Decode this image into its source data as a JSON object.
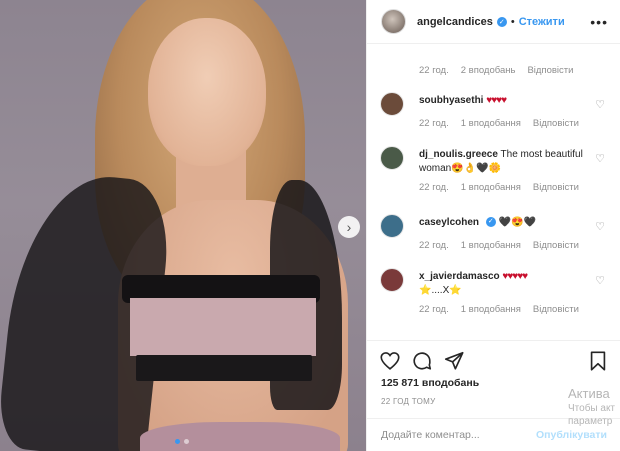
{
  "post": {
    "photo_alt": "",
    "next_icon": "chevron-right-icon",
    "carousel_dots": 2,
    "carousel_active": 1
  },
  "header": {
    "username": "angelcandices",
    "separator": "•",
    "follow_label": "Стежити",
    "more_icon": "•••"
  },
  "caption_meta": {
    "time": "22 год.",
    "likes": "2 вподобань",
    "reply": "Відповісти"
  },
  "comments": [
    {
      "user": "soubhyasethi",
      "text": "",
      "emoji": "♥♥♥♥",
      "time": "22 год.",
      "likes": "1 вподобання",
      "reply": "Відповісти",
      "avatar_color": "#6b4b3a"
    },
    {
      "user": "dj_noulis.greece",
      "text": "The most beautiful woman",
      "emoji": "😍👌🖤🌼",
      "time": "22 год.",
      "likes": "1 вподобання",
      "reply": "Відповісти",
      "avatar_color": "#4a5a48"
    },
    {
      "user": "caseylcohen",
      "text": "",
      "emoji": "🖤😍🖤",
      "time": "22 год.",
      "likes": "1 вподобання",
      "reply": "Відповісти",
      "avatar_color": "#3d6e8a",
      "verified": true
    },
    {
      "user": "x_javierdamasco",
      "text": "",
      "emoji": "♥♥♥♥♥",
      "second_line": "⭐....X⭐",
      "time": "22 год.",
      "likes": "1 вподобання",
      "reply": "Відповісти",
      "avatar_color": "#7a3a3a"
    }
  ],
  "actions": {
    "like_icon": "heart-icon",
    "comment_icon": "comment-icon",
    "share_icon": "send-icon",
    "save_icon": "bookmark-icon"
  },
  "likes_count": "125 871 вподобань",
  "time_ago": "22 ГОД ТОМУ",
  "add_comment": {
    "placeholder": "Додайте коментар...",
    "publish_label": "Опублікувати"
  },
  "watermark": {
    "line1": "Актива",
    "line2": "Чтобы акт",
    "line3": "параметр"
  },
  "colors": {
    "accent": "#3897f0",
    "publish_disabled": "#b2dffc",
    "muted": "#8e8e8e",
    "heart": "#c8102e"
  }
}
